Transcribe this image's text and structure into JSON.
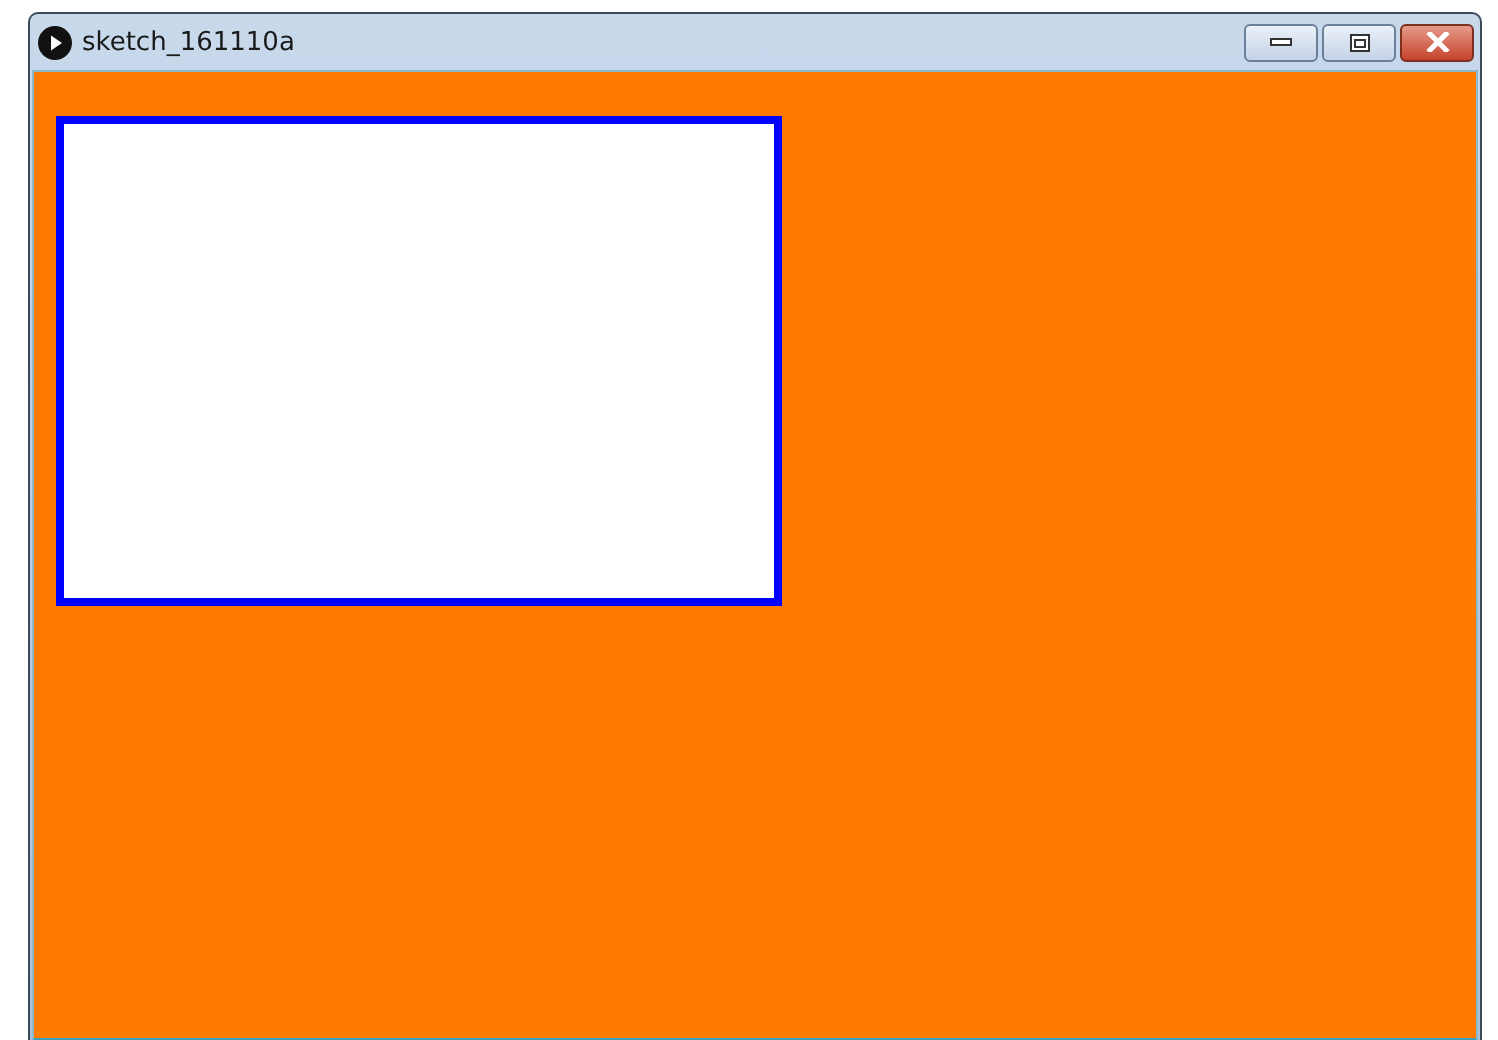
{
  "window": {
    "title": "sketch_161110a"
  },
  "canvas": {
    "kind": "sketch"
  }
}
